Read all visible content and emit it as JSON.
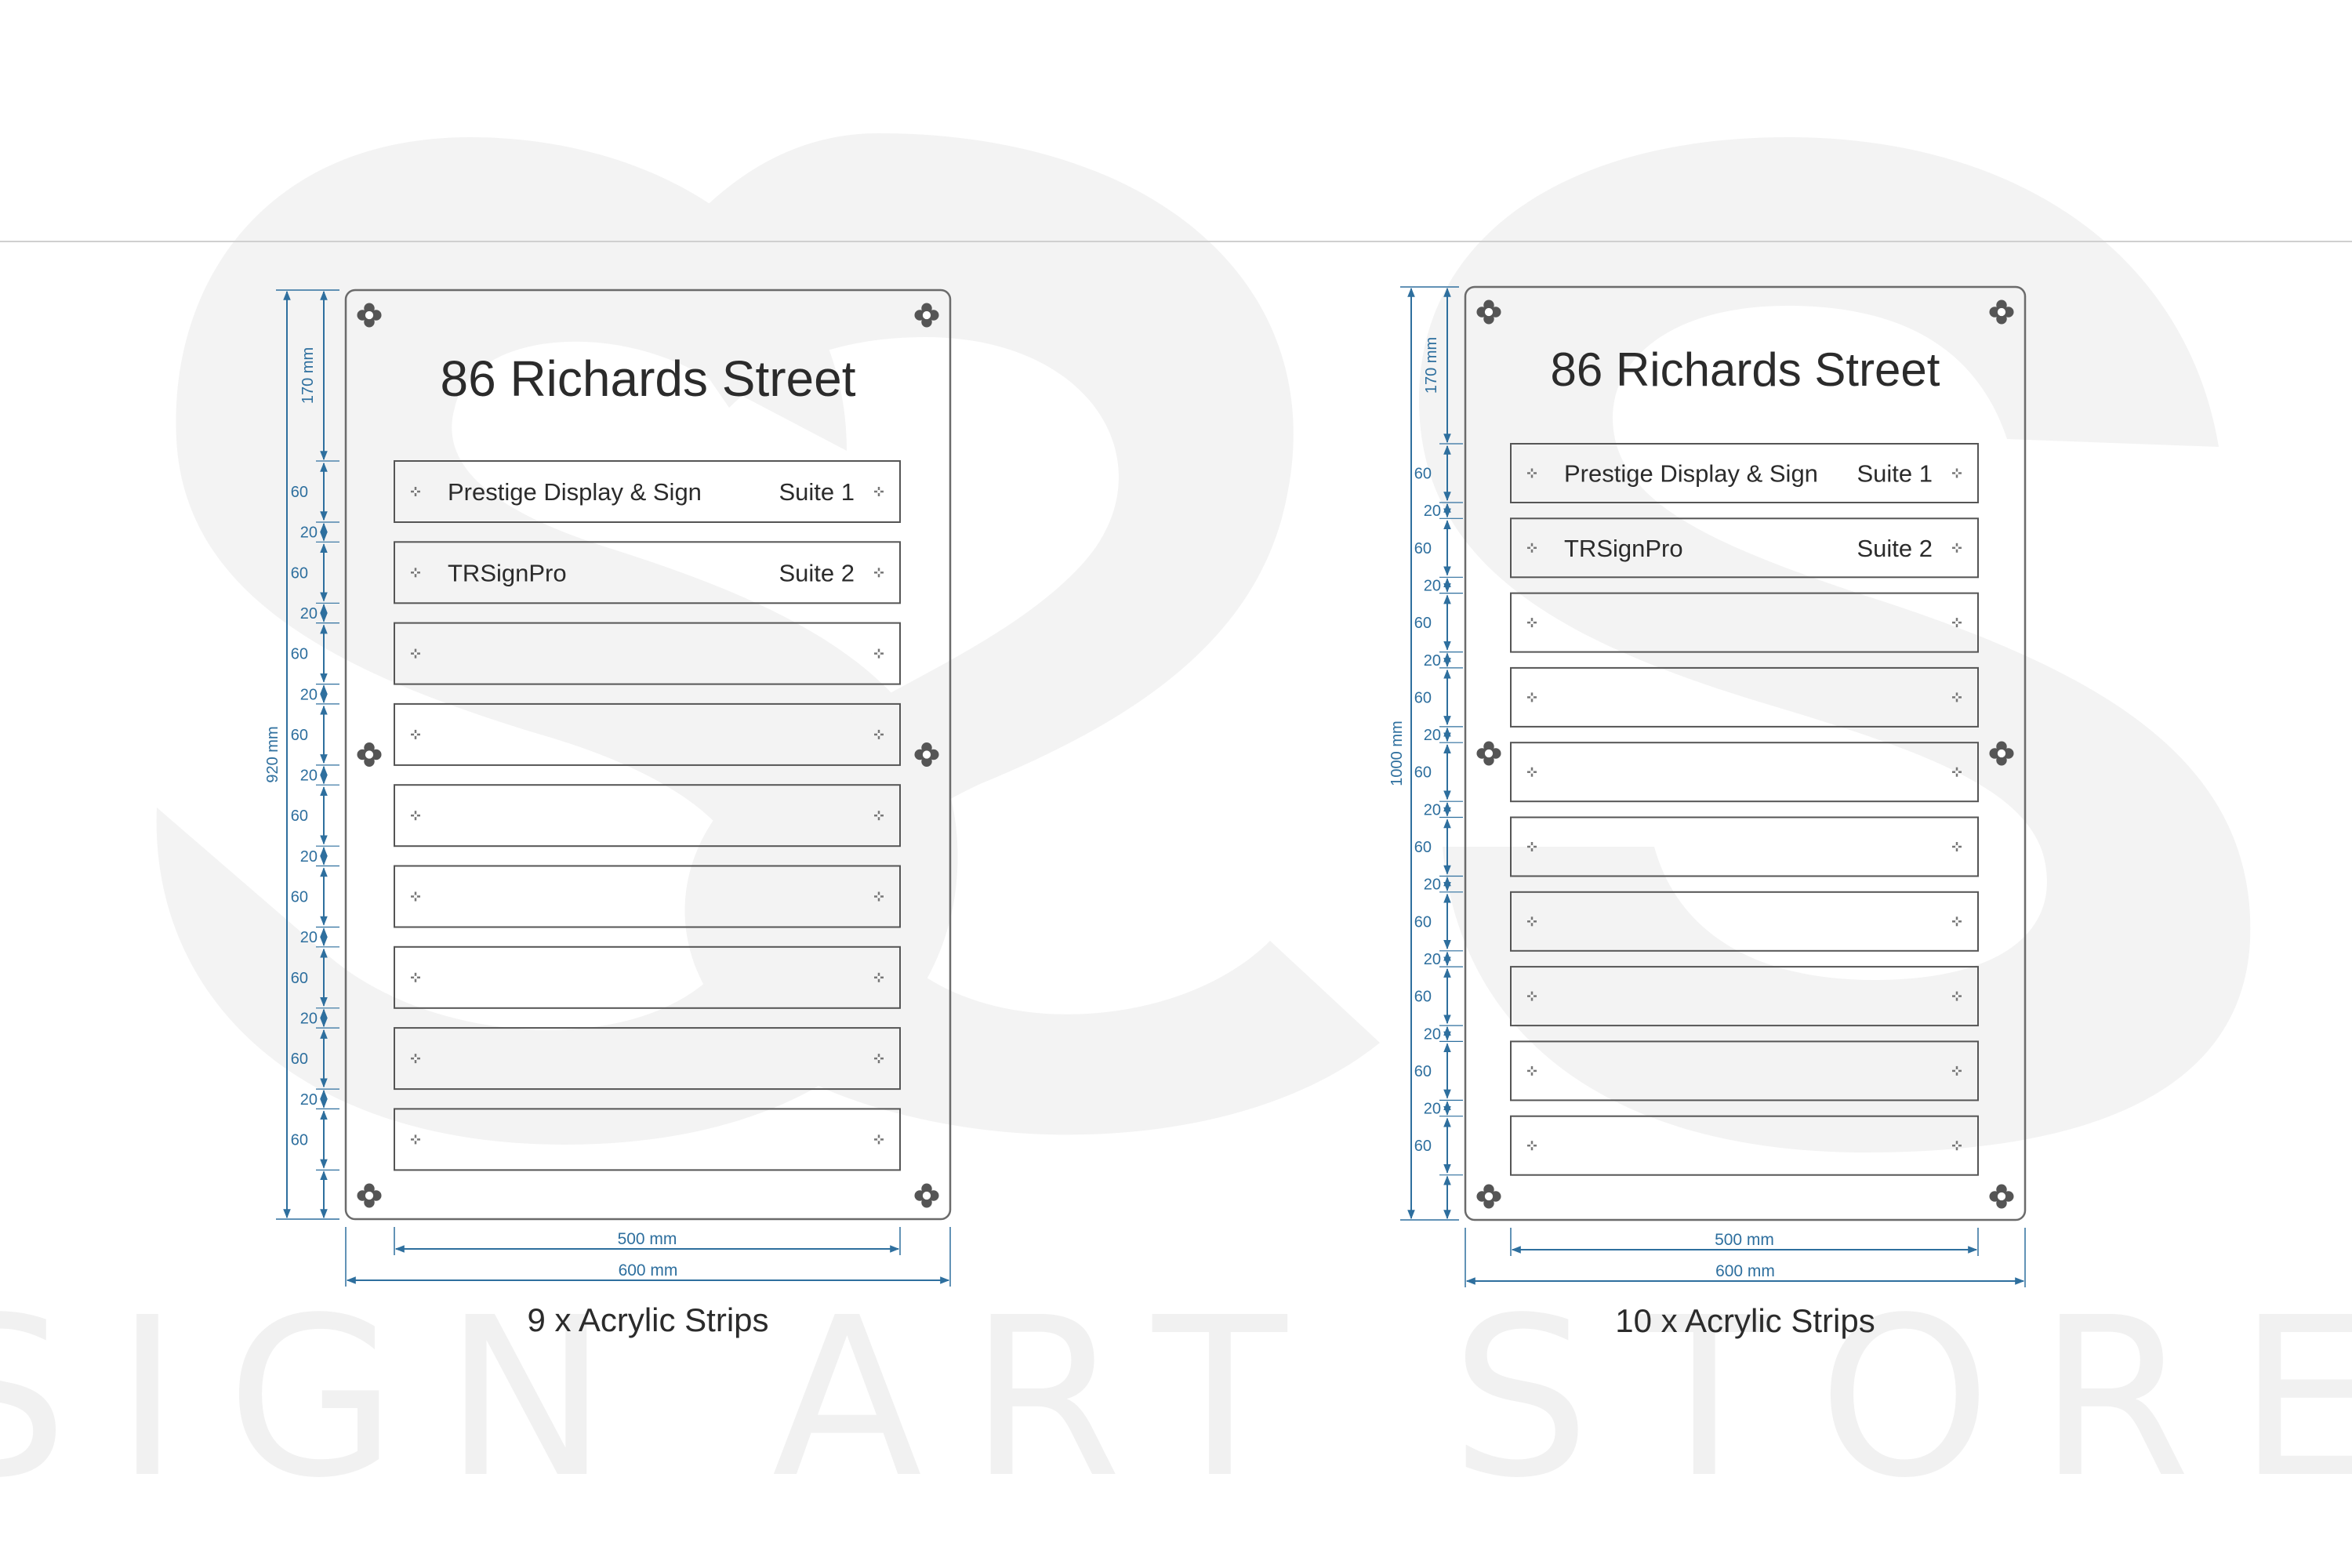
{
  "watermark": {
    "brand_text": "SIGN ART STORE",
    "color": "#f2f2f2"
  },
  "colors": {
    "dimension": "#2e6f9e",
    "panel_border": "#6b6b6b",
    "text": "#2b2b2b",
    "screw": "#555555"
  },
  "boards": [
    {
      "title": "86 Richards Street",
      "caption": "9 x Acrylic Strips",
      "total_height_label": "920 mm",
      "top_margin_label": "170 mm",
      "strip_height_label": "60",
      "gap_label": "20",
      "inner_width_label": "500 mm",
      "outer_width_label": "600 mm",
      "strip_count": 9,
      "strips": [
        {
          "name": "Prestige Display & Sign",
          "suite": "Suite 1"
        },
        {
          "name": "TRSignPro",
          "suite": "Suite 2"
        },
        {
          "name": "",
          "suite": ""
        },
        {
          "name": "",
          "suite": ""
        },
        {
          "name": "",
          "suite": ""
        },
        {
          "name": "",
          "suite": ""
        },
        {
          "name": "",
          "suite": ""
        },
        {
          "name": "",
          "suite": ""
        },
        {
          "name": "",
          "suite": ""
        }
      ]
    },
    {
      "title": "86 Richards Street",
      "caption": "10 x Acrylic Strips",
      "total_height_label": "1000 mm",
      "top_margin_label": "170 mm",
      "strip_height_label": "60",
      "gap_label": "20",
      "inner_width_label": "500 mm",
      "outer_width_label": "600 mm",
      "strip_count": 10,
      "strips": [
        {
          "name": "Prestige Display & Sign",
          "suite": "Suite 1"
        },
        {
          "name": "TRSignPro",
          "suite": "Suite 2"
        },
        {
          "name": "",
          "suite": ""
        },
        {
          "name": "",
          "suite": ""
        },
        {
          "name": "",
          "suite": ""
        },
        {
          "name": "",
          "suite": ""
        },
        {
          "name": "",
          "suite": ""
        },
        {
          "name": "",
          "suite": ""
        },
        {
          "name": "",
          "suite": ""
        },
        {
          "name": "",
          "suite": ""
        }
      ]
    }
  ]
}
